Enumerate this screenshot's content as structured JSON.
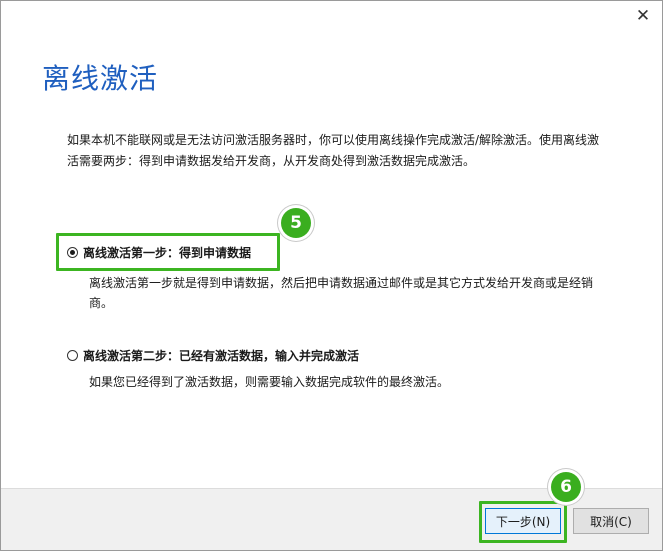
{
  "window": {
    "close_label": "✕"
  },
  "header": {
    "title": "离线激活"
  },
  "intro": {
    "text": "如果本机不能联网或是无法访问激活服务器时，你可以使用离线操作完成激活/解除激活。使用离线激活需要两步：得到申请数据发给开发商，从开发商处得到激活数据完成激活。"
  },
  "options": [
    {
      "label": "离线激活第一步：得到申请数据",
      "description": "离线激活第一步就是得到申请数据，然后把申请数据通过邮件或是其它方式发给开发商或是经销商。",
      "selected": true
    },
    {
      "label": "离线激活第二步：已经有激活数据，输入并完成激活",
      "description": "如果您已经得到了激活数据，则需要输入数据完成软件的最终激活。",
      "selected": false
    }
  ],
  "annotations": {
    "step5": "5",
    "step6": "6",
    "highlight_color": "#3cb521"
  },
  "footer": {
    "next_label": "下一步(N)",
    "cancel_label": "取消(C)"
  },
  "colors": {
    "title": "#1f5fbf",
    "primary_border": "#0078d7"
  }
}
